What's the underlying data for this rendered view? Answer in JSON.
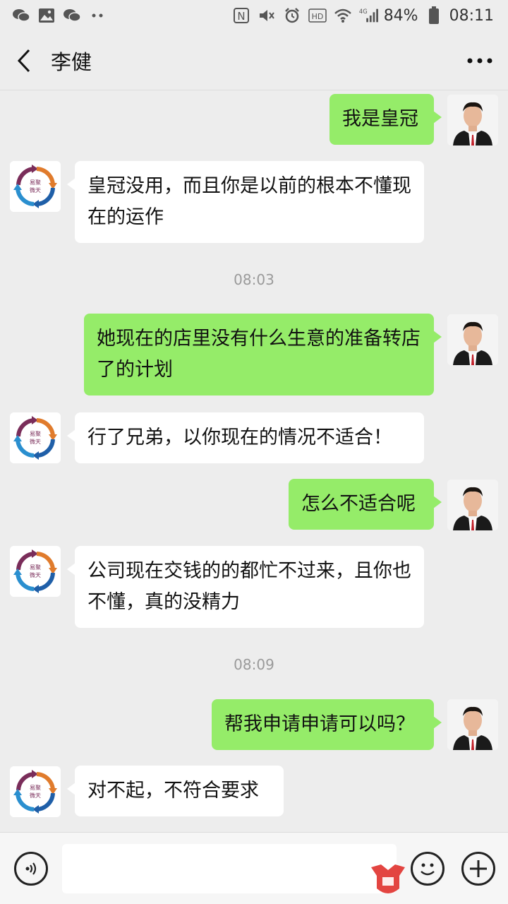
{
  "status_bar": {
    "battery": "84%",
    "time": "08:11",
    "hd": "HD",
    "net": "4G",
    "left_icons": [
      "wechat-icon",
      "gallery-icon",
      "wechat-icon",
      "more-dots-icon"
    ],
    "right_icons": [
      "nfc-icon",
      "mute-icon",
      "alarm-icon",
      "hd-icon",
      "wifi-icon",
      "signal-icon",
      "battery-icon"
    ]
  },
  "nav": {
    "title": "李健",
    "back_icon": "chevron-left-icon",
    "more_icon": "more-horizontal-icon"
  },
  "messages": [
    {
      "side": "me",
      "text": "我是皇冠"
    },
    {
      "side": "other",
      "text": "皇冠没用，而且你是以前的根本不懂现在的运作"
    },
    {
      "time": "08:03"
    },
    {
      "side": "me",
      "text": "她现在的店里没有什么生意的准备转店了的计划"
    },
    {
      "side": "other",
      "text": "行了兄弟，以你现在的情况不适合！"
    },
    {
      "side": "me",
      "text": "怎么不适合呢"
    },
    {
      "side": "other",
      "text": "公司现在交钱的的都忙不过来，且你也不懂，真的没精力"
    },
    {
      "time": "08:09"
    },
    {
      "side": "me",
      "text": "帮我申请申请可以吗？"
    },
    {
      "side": "other",
      "text": "对不起，不符合要求"
    }
  ],
  "avatars": {
    "me": "man-portrait-avatar",
    "other": "circular-arrows-logo-avatar",
    "other_logo_text": "易聚 微天"
  },
  "input_bar": {
    "voice_icon": "voice-icon",
    "emoji_icon": "emoji-icon",
    "plus_icon": "plus-icon",
    "input_value": ""
  },
  "colors": {
    "me_bubble": "#95ec69",
    "other_bubble": "#ffffff",
    "background": "#ededed"
  }
}
